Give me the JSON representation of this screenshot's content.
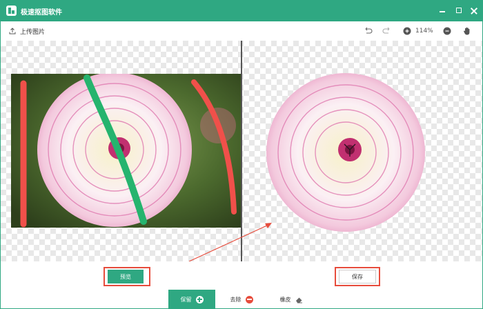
{
  "window": {
    "title": "极速抠图软件"
  },
  "toolbar": {
    "upload_label": "上传图片",
    "zoom": "114%"
  },
  "actions": {
    "preview_label": "预览",
    "save_label": "保存"
  },
  "modes": {
    "keep_label": "保留",
    "remove_label": "去除",
    "eraser_label": "橡皮"
  },
  "colors": {
    "accent": "#2fa882",
    "highlight": "#e74c3c",
    "keep_stroke": "#25b46e",
    "remove_stroke": "#f0504a"
  },
  "icons": [
    "upload-icon",
    "undo-icon",
    "redo-icon",
    "zoom-in-icon",
    "zoom-out-icon",
    "hand-icon",
    "plus-circle-icon",
    "minus-circle-icon",
    "eraser-icon"
  ]
}
